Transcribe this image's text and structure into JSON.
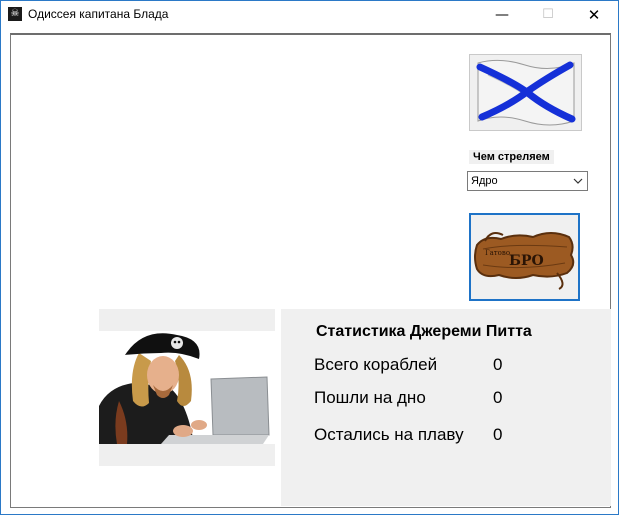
{
  "window": {
    "title": "Одиссея капитана Блада",
    "icon": "pirate-flag-icon",
    "controls": {
      "minimize": "—",
      "maximize": "☐",
      "close": "✕"
    }
  },
  "weapon": {
    "label": "Чем стреляем",
    "selected": "Ядро"
  },
  "fire_button": {
    "text_small": "Гатово",
    "text_big": "БРО"
  },
  "stats": {
    "title": "Статистика Джереми Питта",
    "rows": [
      {
        "label": "Всего кораблей",
        "value": "0"
      },
      {
        "label": "Пошли на дно",
        "value": "0"
      },
      {
        "label": "Остались на плаву",
        "value": "0"
      }
    ]
  },
  "colors": {
    "accent": "#1e73c7",
    "flag_cross": "#1530d8",
    "panel_bg": "#f0f0f0"
  }
}
